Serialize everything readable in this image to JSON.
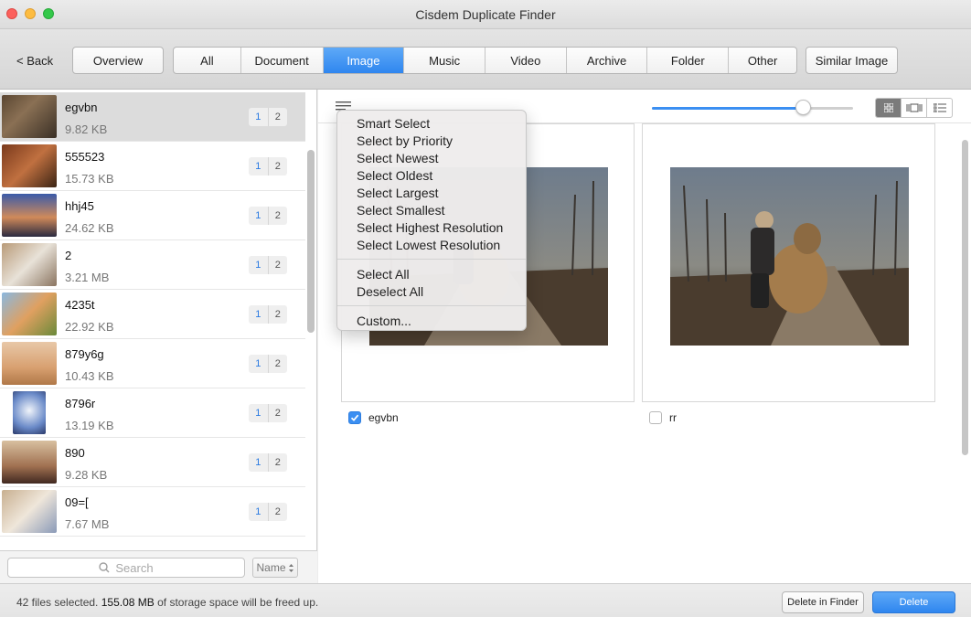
{
  "window": {
    "title": "Cisdem Duplicate Finder"
  },
  "toolbar": {
    "back_label": "< Back",
    "overview_label": "Overview",
    "similar_image_label": "Similar Image",
    "tabs": [
      {
        "label": "All",
        "active": false
      },
      {
        "label": "Document",
        "active": false
      },
      {
        "label": "Image",
        "active": true
      },
      {
        "label": "Music",
        "active": false
      },
      {
        "label": "Video",
        "active": false
      },
      {
        "label": "Archive",
        "active": false
      },
      {
        "label": "Folder",
        "active": false
      },
      {
        "label": "Other",
        "active": false
      }
    ]
  },
  "file_list": {
    "items": [
      {
        "name": "egvbn",
        "size": "9.82 KB",
        "badge_a": "1",
        "badge_b": "2",
        "selected": true
      },
      {
        "name": "555523",
        "size": "15.73 KB",
        "badge_a": "1",
        "badge_b": "2"
      },
      {
        "name": "hhj45",
        "size": "24.62 KB",
        "badge_a": "1",
        "badge_b": "2"
      },
      {
        "name": "2",
        "size": "3.21 MB",
        "badge_a": "1",
        "badge_b": "2"
      },
      {
        "name": "4235t",
        "size": "22.92 KB",
        "badge_a": "1",
        "badge_b": "2"
      },
      {
        "name": "879y6g",
        "size": "10.43 KB",
        "badge_a": "1",
        "badge_b": "2"
      },
      {
        "name": "8796r",
        "size": "13.19 KB",
        "badge_a": "1",
        "badge_b": "2"
      },
      {
        "name": "890",
        "size": "9.28 KB",
        "badge_a": "1",
        "badge_b": "2"
      },
      {
        "name": "09=[",
        "size": "7.67 MB",
        "badge_a": "1",
        "badge_b": "2"
      }
    ],
    "search_placeholder": "Search",
    "sort_label": "Name"
  },
  "preview": {
    "zoom_percent": 75,
    "cards": [
      {
        "name": "egvbn",
        "checked": true
      },
      {
        "name": "rr",
        "checked": false
      }
    ]
  },
  "select_menu": {
    "groups": [
      [
        "Smart Select",
        "Select by Priority",
        "Select Newest",
        "Select Oldest",
        "Select Largest",
        "Select Smallest",
        "Select Highest Resolution",
        "Select Lowest Resolution"
      ],
      [
        "Select All",
        "Deselect All"
      ],
      [
        "Custom..."
      ]
    ]
  },
  "status_bar": {
    "count_text": "42 files selected.",
    "size_text": "155.08 MB",
    "suffix_text": "of storage space will be freed up.",
    "delete_in_finder_label": "Delete in Finder",
    "delete_label": "Delete"
  },
  "colors": {
    "accent": "#3b8ff2",
    "badge_blue": "#2a7ae2"
  }
}
